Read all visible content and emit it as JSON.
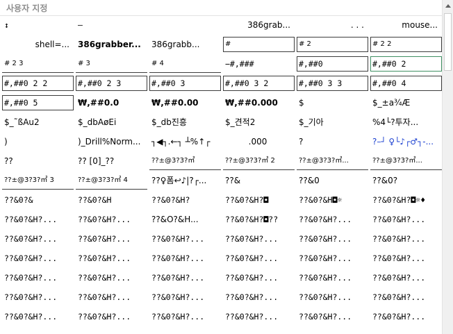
{
  "window": {
    "title": "사용자 지정"
  },
  "cells": [
    {
      "text": "↕",
      "style": "mono"
    },
    {
      "text": "–",
      "style": "mono"
    },
    {
      "text": "",
      "style": ""
    },
    {
      "text": "386grab...",
      "style": "r"
    },
    {
      "text": ". . .",
      "style": "r"
    },
    {
      "text": "mouse...",
      "style": "r"
    },
    {
      "text": "shell=...",
      "style": "r"
    },
    {
      "text": "386grabber...",
      "style": "bold"
    },
    {
      "text": "386grabb...",
      "style": ""
    },
    {
      "text": "#",
      "style": "box small"
    },
    {
      "text": "# 2",
      "style": "box small"
    },
    {
      "text": "# 2 2",
      "style": "box small"
    },
    {
      "text": "# 2 3",
      "style": "uline small"
    },
    {
      "text": "# 3",
      "style": "uline small"
    },
    {
      "text": "# 4",
      "style": "uline small"
    },
    {
      "text": "−#,###",
      "style": "mono"
    },
    {
      "text": "#,##0",
      "style": "box mono"
    },
    {
      "text": "#,##0  2",
      "style": "box sel mono"
    },
    {
      "text": "#,##0  2  2",
      "style": "box mono"
    },
    {
      "text": "#,##0  2  3",
      "style": "box mono"
    },
    {
      "text": "#,##0  3",
      "style": "box mono"
    },
    {
      "text": "#,##0  3  2",
      "style": "box mono"
    },
    {
      "text": "#,##0  3  3",
      "style": "box mono"
    },
    {
      "text": "#,##0  4",
      "style": "box mono"
    },
    {
      "text": "#,##0  5",
      "style": "box mono"
    },
    {
      "text": "₩,##0.0",
      "style": "bold"
    },
    {
      "text": "₩,##0.00",
      "style": "bold"
    },
    {
      "text": "₩,##0.000",
      "style": "bold"
    },
    {
      "text": "$",
      "style": ""
    },
    {
      "text": "$_±a¾Æ",
      "style": ""
    },
    {
      "text": "$_˜ßAu2",
      "style": ""
    },
    {
      "text": "$_dbAøEi",
      "style": ""
    },
    {
      "text": "$_db진흥",
      "style": ""
    },
    {
      "text": "$_견적2",
      "style": ""
    },
    {
      "text": "$_기아",
      "style": ""
    },
    {
      "text": "%4└?투자...",
      "style": ""
    },
    {
      "text": ")",
      "style": ""
    },
    {
      "text": ")_Drill%Norm...",
      "style": ""
    },
    {
      "text": "┐◀┐.←┐ ┴%↑┌",
      "style": ""
    },
    {
      "text": ".000",
      "style": "c"
    },
    {
      "text": "?",
      "style": ""
    },
    {
      "text": "?–┘ ♀└♪┌♂┐-...",
      "style": "blue"
    },
    {
      "text": "??",
      "style": ""
    },
    {
      "text": "?? [0]_??",
      "style": ""
    },
    {
      "text": "??±@3?3?㎡",
      "style": "uline small"
    },
    {
      "text": "??±@3?3?㎡  2",
      "style": "uline small"
    },
    {
      "text": "??±@3?3?㎡...",
      "style": "uline small"
    },
    {
      "text": "??±@3?3?㎡...",
      "style": "uline small"
    },
    {
      "text": "??±@3?3?㎡  3",
      "style": "uline small"
    },
    {
      "text": "??±@3?3?㎡  4",
      "style": "uline small"
    },
    {
      "text": "??♀폼↩♪|?┌...",
      "style": ""
    },
    {
      "text": "??&",
      "style": ""
    },
    {
      "text": "??&0",
      "style": ""
    },
    {
      "text": "??&0?",
      "style": ""
    },
    {
      "text": "??&0?&",
      "style": "mono"
    },
    {
      "text": "??&0?&H",
      "style": "mono"
    },
    {
      "text": "??&0?&H?",
      "style": "mono"
    },
    {
      "text": "??&0?&H?◘",
      "style": "mono"
    },
    {
      "text": "??&0?&H◘☼",
      "style": "mono"
    },
    {
      "text": "??&0?&H?◘☼♦",
      "style": "mono"
    },
    {
      "text": "??&0?&H?...",
      "style": "mono"
    },
    {
      "text": "??&0?&H?...",
      "style": "mono"
    },
    {
      "text": "??&O?&H...",
      "style": ""
    },
    {
      "text": "??&0?&H?◘??",
      "style": "mono"
    },
    {
      "text": "??&0?&H?...",
      "style": "mono"
    },
    {
      "text": "??&0?&H?...",
      "style": "mono"
    },
    {
      "text": "??&0?&H?...",
      "style": "mono"
    },
    {
      "text": "??&0?&H?...",
      "style": "mono"
    },
    {
      "text": "??&0?&H?...",
      "style": "mono"
    },
    {
      "text": "??&0?&H?...",
      "style": "mono"
    },
    {
      "text": "??&0?&H?...",
      "style": "mono"
    },
    {
      "text": "??&0?&H?...",
      "style": "mono"
    },
    {
      "text": "??&0?&H?...",
      "style": "mono"
    },
    {
      "text": "??&0?&H?...",
      "style": "mono"
    },
    {
      "text": "??&0?&H?...",
      "style": "mono"
    },
    {
      "text": "??&0?&H?...",
      "style": "mono"
    },
    {
      "text": "??&0?&H?...",
      "style": "mono"
    },
    {
      "text": "??&0?&H?...",
      "style": "mono"
    },
    {
      "text": "??&0?&H?...",
      "style": "mono"
    },
    {
      "text": "??&0?&H?...",
      "style": "mono"
    },
    {
      "text": "??&0?&H?...",
      "style": "mono"
    },
    {
      "text": "??&0?&H?...",
      "style": "mono"
    },
    {
      "text": "??&0?&H?...",
      "style": "mono"
    },
    {
      "text": "??&0?&H?...",
      "style": "mono"
    },
    {
      "text": "??&0?&H?...",
      "style": "mono"
    },
    {
      "text": "??&0?&H?...",
      "style": "mono"
    },
    {
      "text": "??&0?&H?...",
      "style": "mono"
    },
    {
      "text": "??&0?&H?...",
      "style": "mono"
    },
    {
      "text": "??&0?&H?...",
      "style": "mono"
    },
    {
      "text": "??&0?&H?...",
      "style": "mono"
    },
    {
      "text": "??&0?&H?...",
      "style": "mono"
    },
    {
      "text": "??&0?&H?...",
      "style": "mono"
    },
    {
      "text": "??&0?&H?...",
      "style": "mono"
    },
    {
      "text": "??&0?&H?...",
      "style": "mono"
    },
    {
      "text": "??&0?&H?...",
      "style": "mono"
    },
    {
      "text": "??&0?&H?...",
      "style": "mono"
    }
  ],
  "colors": {
    "title": "#8f8f8f",
    "selected_border": "#3f8f63",
    "link_blue": "#1a3fd0"
  },
  "icons": {
    "scroll_up": "up-arrow-icon"
  }
}
